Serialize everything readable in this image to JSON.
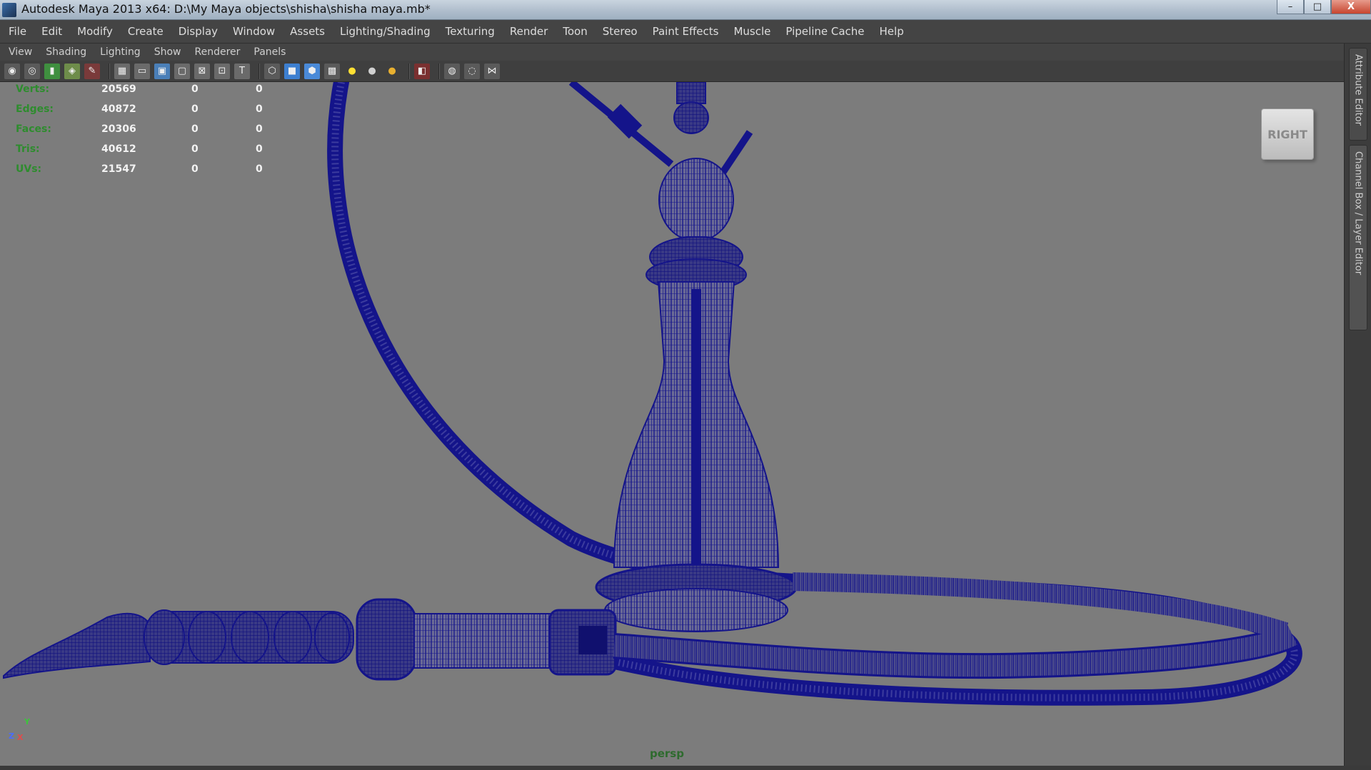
{
  "window": {
    "title": "Autodesk Maya 2013 x64: D:\\My Maya objects\\shisha\\shisha maya.mb*",
    "minimize": "–",
    "maximize": "□",
    "close": "X"
  },
  "menubar": [
    "File",
    "Edit",
    "Modify",
    "Create",
    "Display",
    "Window",
    "Assets",
    "Lighting/Shading",
    "Texturing",
    "Render",
    "Toon",
    "Stereo",
    "Paint Effects",
    "Muscle",
    "Pipeline Cache",
    "Help"
  ],
  "panel_menu": [
    "View",
    "Shading",
    "Lighting",
    "Show",
    "Renderer",
    "Panels"
  ],
  "toolbar_icons": [
    "camera-select-icon",
    "camera-attributes-icon",
    "bookmark-icon",
    "image-plane-icon",
    "grease-pencil-icon",
    "grid-icon",
    "film-gate-icon",
    "resolution-gate-icon",
    "gate-mask-icon",
    "field-chart-icon",
    "safe-action-icon",
    "safe-title-icon",
    "wireframe-icon",
    "smooth-shade-icon",
    "shade-wire-icon",
    "texture-icon",
    "default-light-icon",
    "shadows-icon",
    "ambient-occlusion-icon",
    "isolate-select-icon",
    "xray-icon",
    "xray-joints-icon",
    "hud-icon"
  ],
  "hud": {
    "rows": [
      {
        "label": "Verts:",
        "v1": "20569",
        "v2": "0",
        "v3": "0"
      },
      {
        "label": "Edges:",
        "v1": "40872",
        "v2": "0",
        "v3": "0"
      },
      {
        "label": "Faces:",
        "v1": "20306",
        "v2": "0",
        "v3": "0"
      },
      {
        "label": "Tris:",
        "v1": "40612",
        "v2": "0",
        "v3": "0"
      },
      {
        "label": "UVs:",
        "v1": "21547",
        "v2": "0",
        "v3": "0"
      }
    ]
  },
  "viewcube_label": "RIGHT",
  "camera_label": "persp",
  "axis": {
    "y": "Y",
    "z": "Z",
    "x": "X"
  },
  "side_tabs": [
    "Attribute Editor",
    "Channel Box / Layer Editor"
  ],
  "colors": {
    "viewport_bg": "#7c7c7c",
    "wireframe": "#14148a",
    "hud_label": "#2e8c2e"
  }
}
